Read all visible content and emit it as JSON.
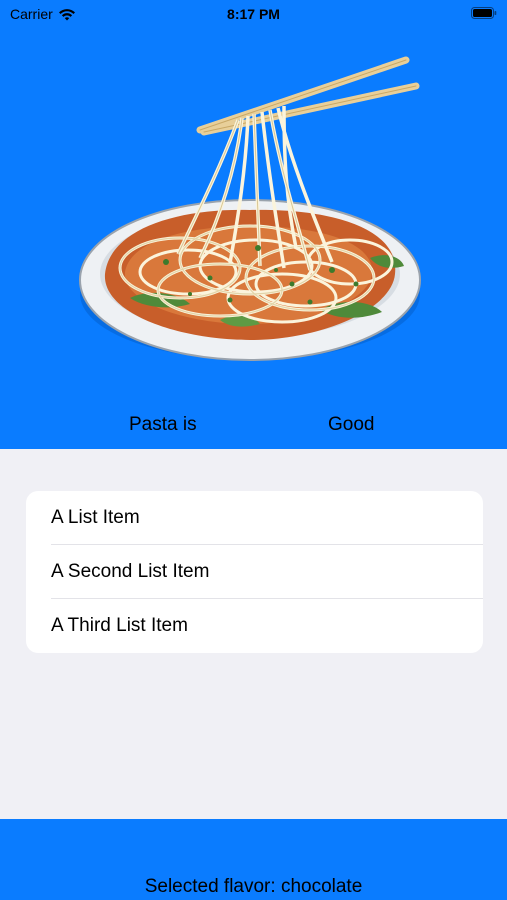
{
  "status_bar": {
    "carrier": "Carrier",
    "time": "8:17 PM"
  },
  "header": {
    "image": "pasta-noodles-illustration",
    "left_label": "Pasta is",
    "right_label": "Good"
  },
  "list": {
    "items": [
      {
        "label": "A List Item"
      },
      {
        "label": "A Second List Item"
      },
      {
        "label": "A Third List Item"
      }
    ]
  },
  "footer": {
    "selected_text": "Selected flavor: chocolate"
  },
  "colors": {
    "accent": "#0a7cff",
    "background": "#f0f0f5",
    "card": "#ffffff"
  }
}
